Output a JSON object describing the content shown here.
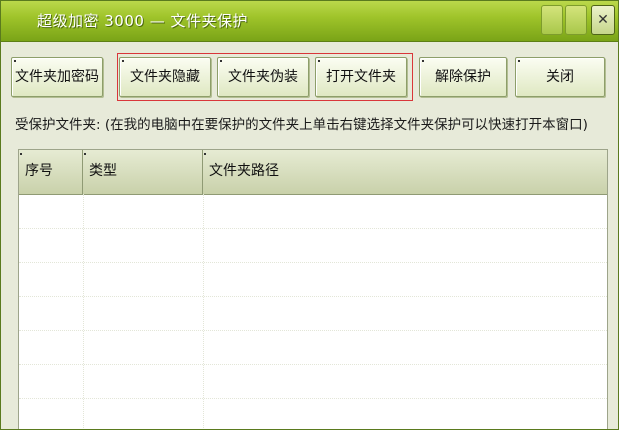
{
  "window": {
    "title": "超级加密 3000 — 文件夹保护"
  },
  "titlebar_buttons": {
    "close_icon": "close-icon",
    "close_glyph": "✕"
  },
  "toolbar": {
    "buttons": [
      {
        "label": "文件夹加密码"
      },
      {
        "label": "文件夹隐藏"
      },
      {
        "label": "文件夹伪装"
      },
      {
        "label": "打开文件夹"
      },
      {
        "label": "解除保护"
      },
      {
        "label": "关闭"
      }
    ],
    "highlight_color": "#d9363a"
  },
  "hint": "受保护文件夹: (在我的电脑中在要保护的文件夹上单击右键选择文件夹保护可以快速打开本窗口)",
  "table": {
    "columns": [
      "序号",
      "类型",
      "文件夹路径"
    ],
    "rows": []
  },
  "colors": {
    "title_bar": "#9fc42a",
    "window_bg": "#e7ead9"
  }
}
